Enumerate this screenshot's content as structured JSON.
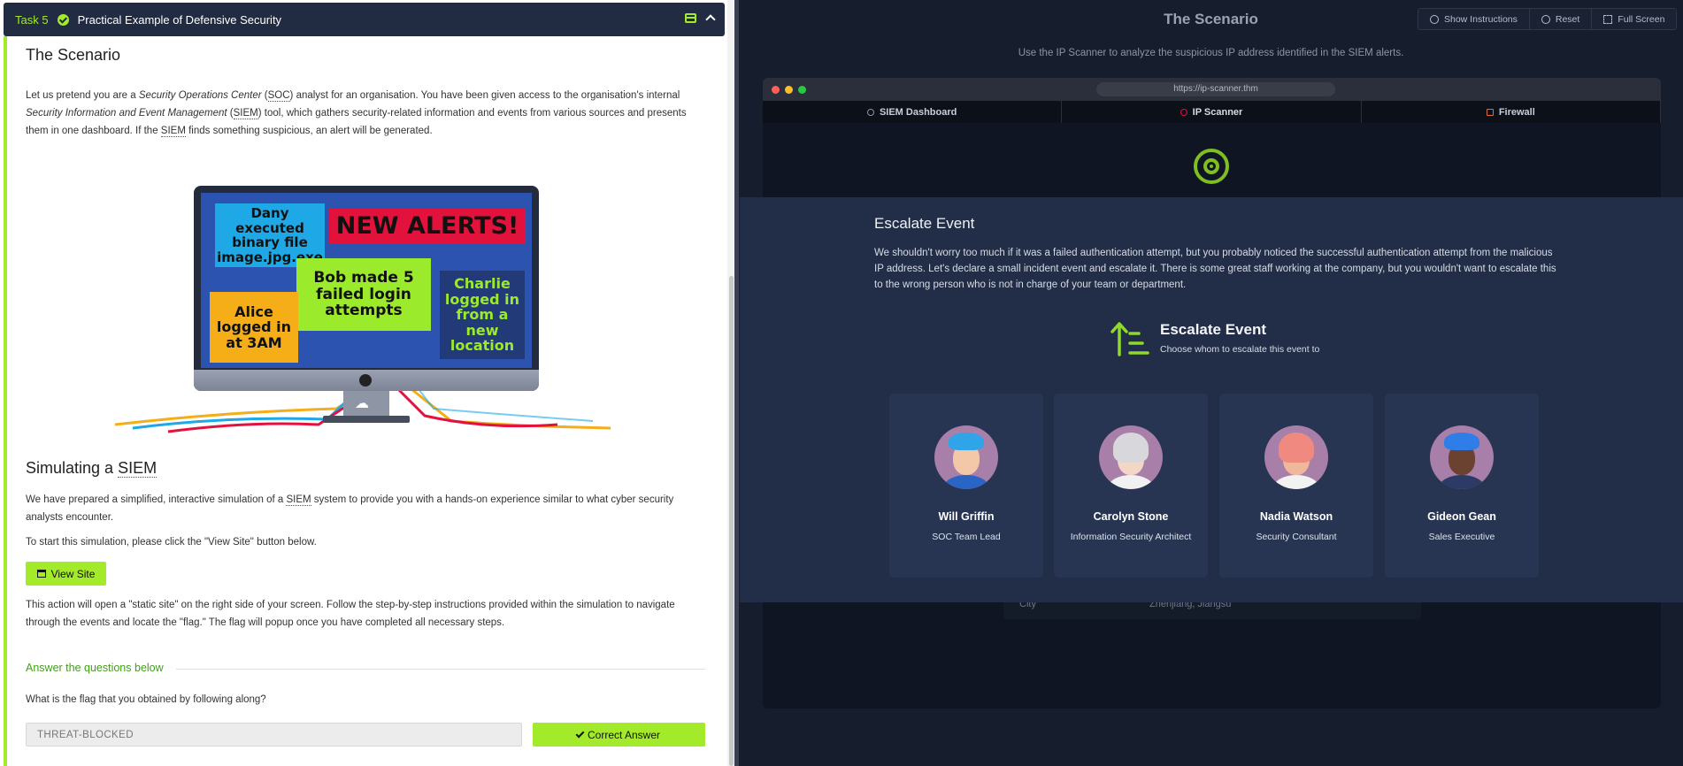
{
  "task": {
    "number": "Task 5",
    "title": "Practical Example of Defensive Security"
  },
  "scenario": {
    "heading": "The Scenario",
    "p1_a": "Let us pretend you are a ",
    "p1_soc_full": "Security Operations Center",
    "p1_soc": "SOC",
    "p1_b": " analyst for an organisation. You have been given access to the organisation's internal ",
    "p1_siem_full": "Security Information and Event Management",
    "p1_siem": "SIEM",
    "p1_c": " tool, which gathers security-related information and events from various sources and presents them in one dashboard. If the ",
    "p1_d": " finds something suspicious, an alert will be generated."
  },
  "illustration": {
    "tile_dany": "Dany executed binary file image.jpg.exe",
    "tile_alerts": "NEW ALERTS!",
    "tile_bob": "Bob made 5 failed login attempts",
    "tile_alice": "Alice logged in at 3AM",
    "tile_charlie": "Charlie logged in from a new location"
  },
  "simulating": {
    "heading_a": "Simulating a ",
    "heading_siem": "SIEM",
    "p1_a": "We have prepared a simplified, interactive simulation of a ",
    "p1_siem": "SIEM",
    "p1_b": " system to provide you with a hands-on experience similar to what cyber security analysts encounter.",
    "p2": "To start this simulation, please click the \"View Site\" button below.",
    "view_site": "View Site",
    "p3": "This action will open a \"static site\" on the right side of your screen. Follow the step-by-step instructions provided within the simulation to navigate through the events and locate the \"flag.\" The flag will popup once you have completed all necessary steps."
  },
  "questions": {
    "heading": "Answer the questions below",
    "q1": "What is the flag that you obtained by following along?",
    "answer": "THREAT-BLOCKED",
    "button": "Correct Answer"
  },
  "right_panel": {
    "title": "The Scenario",
    "show_instructions": "Show Instructions",
    "reset": "Reset",
    "full_screen": "Full Screen",
    "subtitle": "Use the IP Scanner to analyze the suspicious IP address identified in the SIEM alerts."
  },
  "browser": {
    "url": "https://ip-scanner.thm",
    "tabs": [
      "SIEM Dashboard",
      "IP Scanner",
      "Firewall"
    ],
    "city_label": "City",
    "city_value": "Zhenjiang, Jiangsu"
  },
  "modal": {
    "title": "Escalate Event",
    "text": "We shouldn't worry too much if it was a failed authentication attempt, but you probably noticed the successful authentication attempt from the malicious IP address. Let's declare a small incident event and escalate it. There is some great staff working at the company, but you wouldn't want to escalate this to the wrong person who is not in charge of your team or department.",
    "escalate_title": "Escalate Event",
    "escalate_sub": "Choose whom to escalate this event to",
    "people": [
      {
        "name": "Will Griffin",
        "role": "SOC Team Lead"
      },
      {
        "name": "Carolyn Stone",
        "role": "Information Security Architect"
      },
      {
        "name": "Nadia Watson",
        "role": "Security Consultant"
      },
      {
        "name": "Gideon Gean",
        "role": "Sales Executive"
      }
    ]
  },
  "colors": {
    "accent": "#a3ea2a",
    "header_bg": "#212c42",
    "modal_bg": "#222e47",
    "card_bg": "#283552"
  }
}
